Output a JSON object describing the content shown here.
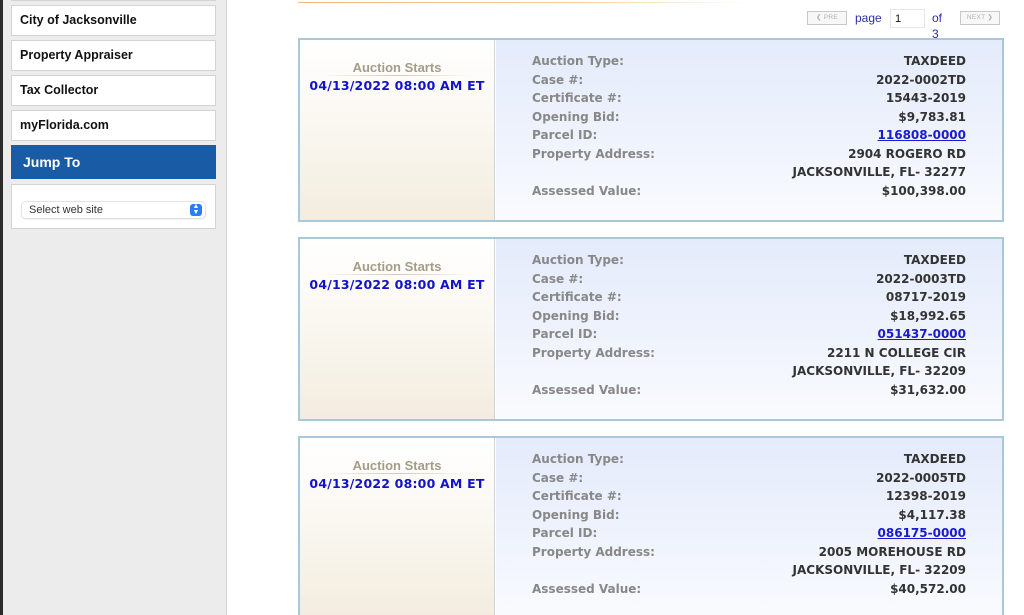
{
  "sidebar": {
    "links": [
      {
        "label": "City of Jacksonville"
      },
      {
        "label": "Property Appraiser"
      },
      {
        "label": "Tax Collector"
      },
      {
        "label": "myFlorida.com"
      }
    ],
    "jump_to": {
      "title": "Jump To",
      "select": {
        "selected": "Select web site"
      }
    }
  },
  "pagination": {
    "prev_label": "❮ PRE",
    "page_label": "page",
    "current_page": "1",
    "of_label": "of 3",
    "next_label": "NEXT ❯"
  },
  "auctions": [
    {
      "starts_label": "Auction Starts",
      "starts": "04/13/2022 08:00 AM ET",
      "fields": {
        "auction_type": {
          "label": "Auction Type:",
          "value": "TAXDEED"
        },
        "case": {
          "label": "Case #:",
          "value": "2022-0002TD"
        },
        "certificate": {
          "label": "Certificate #:",
          "value": "15443-2019"
        },
        "opening_bid": {
          "label": "Opening Bid:",
          "value": "$9,783.81"
        },
        "parcel_id": {
          "label": "Parcel ID:",
          "value": "116808-0000"
        },
        "address": {
          "label": "Property Address:",
          "value": "2904 ROGERO RD"
        },
        "city": {
          "label": "",
          "value": "JACKSONVILLE, FL- 32277"
        },
        "assessed_value": {
          "label": "Assessed Value:",
          "value": "$100,398.00"
        }
      }
    },
    {
      "starts_label": "Auction Starts",
      "starts": "04/13/2022 08:00 AM ET",
      "fields": {
        "auction_type": {
          "label": "Auction Type:",
          "value": "TAXDEED"
        },
        "case": {
          "label": "Case #:",
          "value": "2022-0003TD"
        },
        "certificate": {
          "label": "Certificate #:",
          "value": "08717-2019"
        },
        "opening_bid": {
          "label": "Opening Bid:",
          "value": "$18,992.65"
        },
        "parcel_id": {
          "label": "Parcel ID:",
          "value": "051437-0000"
        },
        "address": {
          "label": "Property Address:",
          "value": "2211 N COLLEGE CIR"
        },
        "city": {
          "label": "",
          "value": "JACKSONVILLE, FL- 32209"
        },
        "assessed_value": {
          "label": "Assessed Value:",
          "value": "$31,632.00"
        }
      }
    },
    {
      "starts_label": "Auction Starts",
      "starts": "04/13/2022 08:00 AM ET",
      "fields": {
        "auction_type": {
          "label": "Auction Type:",
          "value": "TAXDEED"
        },
        "case": {
          "label": "Case #:",
          "value": "2022-0005TD"
        },
        "certificate": {
          "label": "Certificate #:",
          "value": "12398-2019"
        },
        "opening_bid": {
          "label": "Opening Bid:",
          "value": "$4,117.38"
        },
        "parcel_id": {
          "label": "Parcel ID:",
          "value": "086175-0000"
        },
        "address": {
          "label": "Property Address:",
          "value": "2005 MOREHOUSE RD"
        },
        "city": {
          "label": "",
          "value": "JACKSONVILLE, FL- 32209"
        },
        "assessed_value": {
          "label": "Assessed Value:",
          "value": "$40,572.00"
        }
      }
    }
  ],
  "colors": {
    "jump_to_bg": "#1a5ba6",
    "date_blue": "#1212c8",
    "link_blue": "#1a1ad0",
    "card_border": "#a9c9d8",
    "label_gray": "#888888",
    "auction_starts": "#a49d86"
  }
}
